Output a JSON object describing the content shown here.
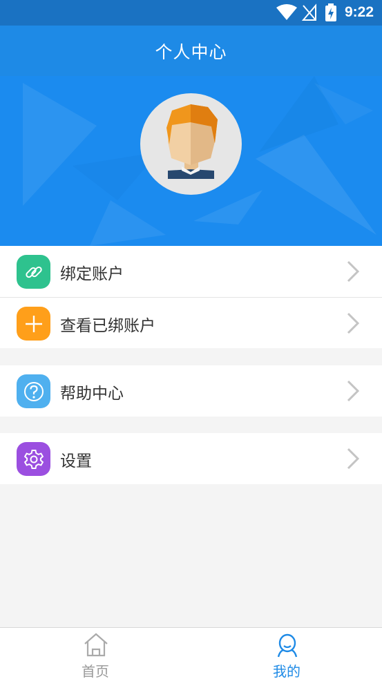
{
  "status_bar": {
    "time": "9:22"
  },
  "header": {
    "title": "个人中心"
  },
  "menu": {
    "group1": [
      {
        "label": "绑定账户",
        "color": "#2ec28e",
        "icon": "link-icon"
      },
      {
        "label": "查看已绑账户",
        "color": "#ff9f1a",
        "icon": "plus-icon"
      }
    ],
    "group2": [
      {
        "label": "帮助中心",
        "color": "#4fb0ef",
        "icon": "question-icon"
      }
    ],
    "group3": [
      {
        "label": "设置",
        "color": "#9b4fe0",
        "icon": "gear-icon"
      }
    ]
  },
  "tabs": [
    {
      "label": "首页",
      "icon": "home-icon",
      "active": false
    },
    {
      "label": "我的",
      "icon": "user-icon",
      "active": true
    }
  ],
  "colors": {
    "accent": "#1e8ae6",
    "tab_inactive": "#999999"
  }
}
